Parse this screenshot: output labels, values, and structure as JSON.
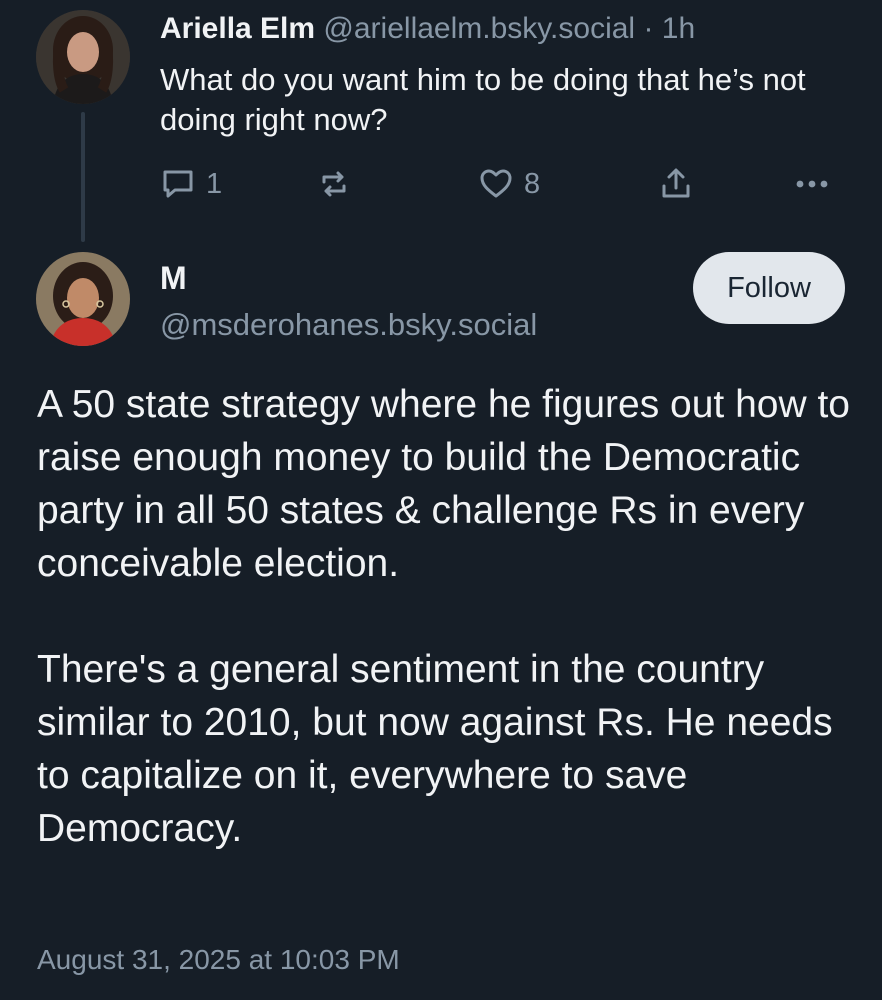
{
  "parent_post": {
    "author_name": "Ariella Elm",
    "handle": "@ariellaelm.bsky.social",
    "separator": "·",
    "time": "1h",
    "text": "What do you want him to be doing that he’s not doing right now?",
    "reply_count": "1",
    "like_count": "8"
  },
  "main_post": {
    "author_name": "M",
    "handle": "@msderohanes.bsky.social",
    "follow_label": "Follow",
    "paragraphs": [
      "A 50 state strategy where he figures out how to raise enough money to build the Democratic party in all 50 states & challenge Rs in every conceivable election.",
      "There's a general sentiment in the country similar to 2010, but now against Rs. He needs to capitalize on it, everywhere to save Democracy."
    ],
    "date": "August 31, 2025 at 10:03 PM"
  },
  "icons": {
    "reply": "speech-bubble-icon",
    "repost": "repost-arrows-icon",
    "like": "heart-outline-icon",
    "share": "share-upload-icon",
    "more": "ellipsis-icon"
  },
  "colors": {
    "background": "#161e27",
    "text": "#f1f3f5",
    "muted": "#8897a6",
    "follow_button": "#e2e7ec"
  }
}
